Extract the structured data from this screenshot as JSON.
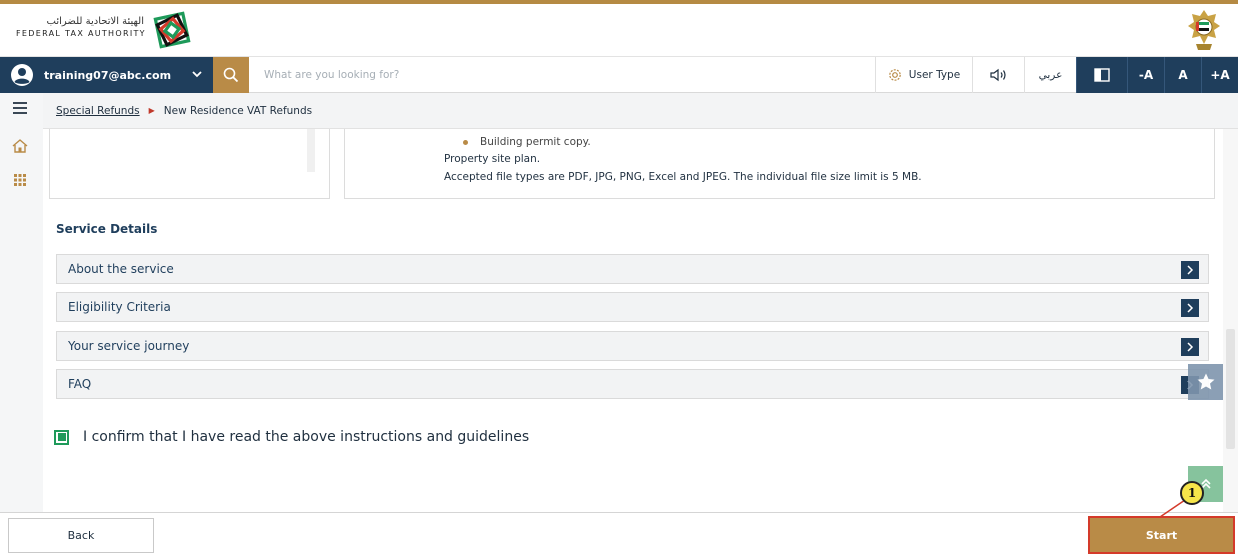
{
  "header": {
    "logo_arabic": "الهيئة الاتحادية للضرائب",
    "logo_english": "FEDERAL TAX AUTHORITY",
    "logo_icon": "fta-logo-icon",
    "emblem_icon": "uae-emblem-icon"
  },
  "toolbar": {
    "user_email": "training07@abc.com",
    "search_placeholder": "What are you looking for?",
    "user_type_label": "User Type",
    "arabic_label": "عربي",
    "font_decrease_label": "-A",
    "font_default_label": "A",
    "font_increase_label": "+A"
  },
  "breadcrumb": {
    "parent": "Special Refunds",
    "current": "New Residence VAT Refunds"
  },
  "documents": {
    "bullet_item": "Building permit copy.",
    "site_plan": "Property site plan.",
    "file_types": "Accepted file types are PDF, JPG, PNG, Excel and JPEG. The individual file size limit is 5 MB."
  },
  "service_details": {
    "title": "Service Details",
    "sections": [
      {
        "label": "About the service"
      },
      {
        "label": "Eligibility Criteria"
      },
      {
        "label": "Your service journey"
      },
      {
        "label": "FAQ"
      }
    ]
  },
  "confirm": {
    "label": "I confirm that I have read the above instructions and guidelines",
    "checked": true
  },
  "footer": {
    "back_label": "Back",
    "start_label": "Start"
  },
  "annotation": {
    "marker": "1"
  },
  "colors": {
    "navy": "#1f3e5c",
    "gold": "#b98b47",
    "green": "#1e9a5a",
    "highlight": "#d43a2a"
  }
}
